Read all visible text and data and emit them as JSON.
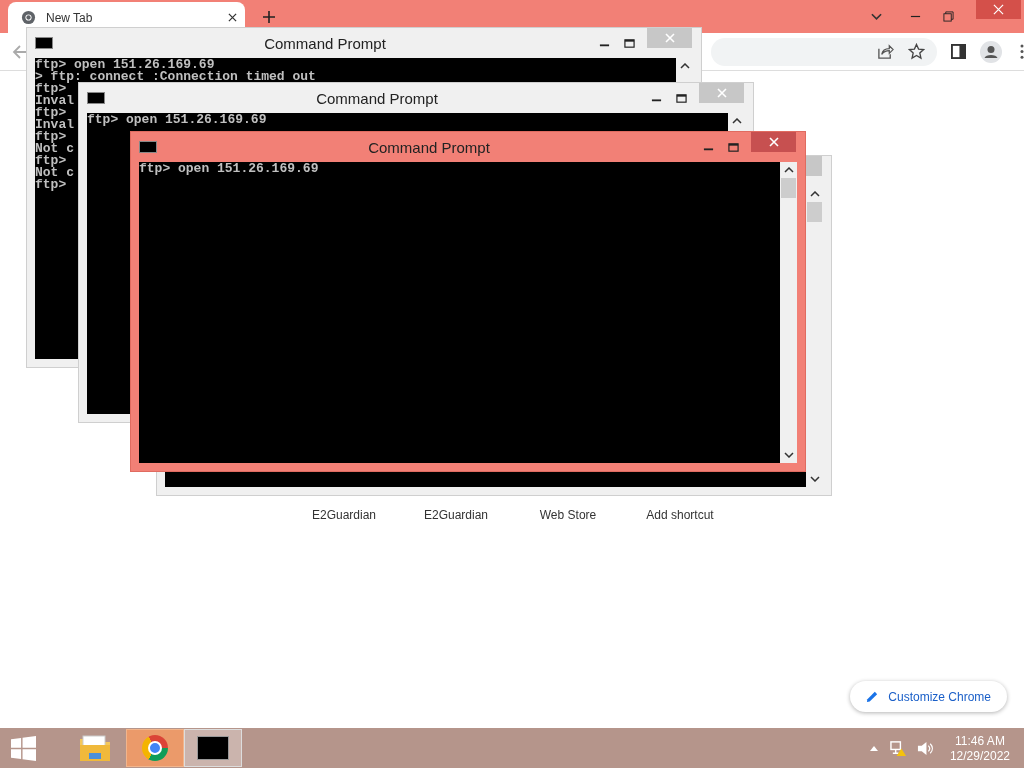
{
  "browser": {
    "tabs": [
      {
        "title": "New Tab",
        "selected": true
      }
    ],
    "shortcuts": [
      "E2Guardian",
      "E2Guardian",
      "Web Store",
      "Add shortcut"
    ],
    "customize_button": "Customize Chrome"
  },
  "console_windows": [
    {
      "title": "Command Prompt",
      "active": false,
      "lines": [
        "ftp> open 151.26.169.69",
        "> ftp: connect :Connection timed out",
        "ftp>",
        "Inval",
        "ftp>",
        "Inval",
        "ftp>",
        "Not c",
        "ftp>",
        "Not c",
        "ftp>"
      ]
    },
    {
      "title": "Command Prompt",
      "active": false,
      "lines": [
        "ftp> open 151.26.169.69"
      ]
    },
    {
      "active": false
    },
    {
      "title": "Command Prompt",
      "active": true,
      "lines": [
        "ftp> open 151.26.169.69"
      ]
    }
  ],
  "taskbar": {
    "apps": [
      {
        "kind": "folder",
        "selected": false
      },
      {
        "kind": "browser",
        "selected": true
      },
      {
        "kind": "console",
        "selected": true
      }
    ],
    "time": "11:46 AM",
    "date": "12/29/2022"
  }
}
